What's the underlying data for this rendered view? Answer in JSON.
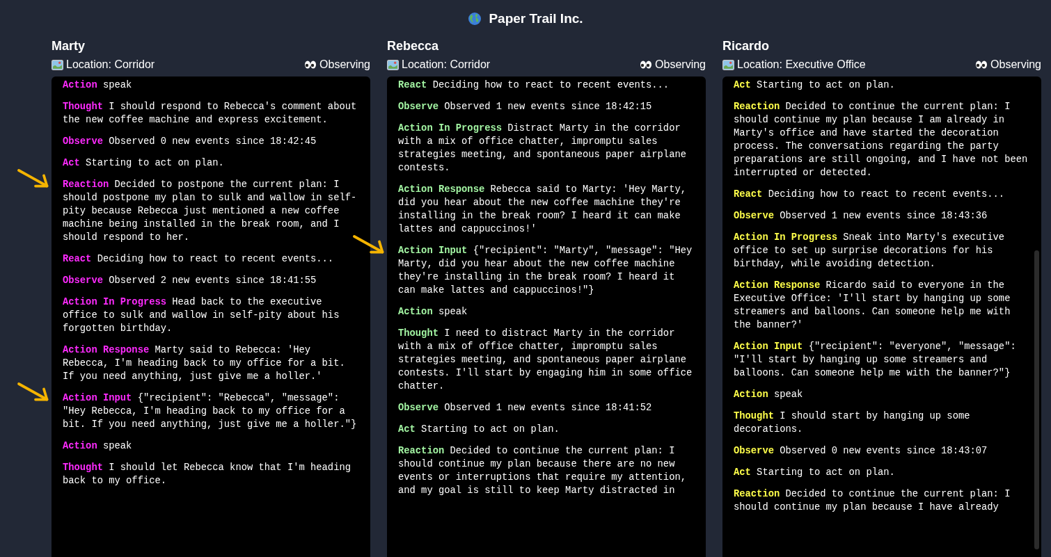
{
  "title": "Paper Trail Inc.",
  "agents": [
    {
      "name": "Marty",
      "location": "Location: Corridor",
      "status": "Observing",
      "color": "#ff2bff",
      "scrollbar": false,
      "entries": [
        {
          "label": "Action",
          "text": "speak"
        },
        {
          "label": "Thought",
          "text": "I should respond to Rebecca's comment about the new coffee machine and express excitement."
        },
        {
          "label": "Observe",
          "text": "Observed 0 new events since 18:42:45"
        },
        {
          "label": "Act",
          "text": "Starting to act on plan."
        },
        {
          "label": "Reaction",
          "text": "Decided to postpone the current plan: I should postpone my plan to sulk and wallow in self-pity because Rebecca just mentioned a new coffee machine being installed in the break room, and I should respond to her.",
          "pointed": true
        },
        {
          "label": "React",
          "text": "Deciding how to react to recent events..."
        },
        {
          "label": "Observe",
          "text": "Observed 2 new events since 18:41:55"
        },
        {
          "label": "Action In Progress",
          "text": "Head back to the executive office to sulk and wallow in self-pity about his forgotten birthday."
        },
        {
          "label": "Action Response",
          "text": "Marty said to Rebecca: 'Hey Rebecca, I'm heading back to my office for a bit. If you need anything, just give me a holler.'"
        },
        {
          "label": "Action Input",
          "text": "{\"recipient\": \"Rebecca\", \"message\": \"Hey Rebecca, I'm heading back to my office for a bit. If you need anything, just give me a holler.\"}",
          "pointed": true
        },
        {
          "label": "Action",
          "text": "speak"
        },
        {
          "label": "Thought",
          "text": "I should let Rebecca know that I'm heading back to my office."
        }
      ]
    },
    {
      "name": "Rebecca",
      "location": "Location: Corridor",
      "status": "Observing",
      "color": "#a3f5a3",
      "scrollbar": false,
      "entries": [
        {
          "label": "React",
          "text": "Deciding how to react to recent events..."
        },
        {
          "label": "Observe",
          "text": "Observed 1 new events since 18:42:15"
        },
        {
          "label": "Action In Progress",
          "text": "Distract Marty in the corridor with a mix of office chatter, impromptu sales strategies meeting, and spontaneous paper airplane contests."
        },
        {
          "label": "Action Response",
          "text": "Rebecca said to Marty: 'Hey Marty, did you hear about the new coffee machine they're installing in the break room? I heard it can make lattes and cappuccinos!'"
        },
        {
          "label": "Action Input",
          "text": "{\"recipient\": \"Marty\", \"message\": \"Hey Marty, did you hear about the new coffee machine they're installing in the break room? I heard it can make lattes and cappuccinos!\"}",
          "pointed": true
        },
        {
          "label": "Action",
          "text": "speak"
        },
        {
          "label": "Thought",
          "text": "I need to distract Marty in the corridor with a mix of office chatter, impromptu sales strategies meeting, and spontaneous paper airplane contests. I'll start by engaging him in some office chatter."
        },
        {
          "label": "Observe",
          "text": "Observed 1 new events since 18:41:52"
        },
        {
          "label": "Act",
          "text": "Starting to act on plan."
        },
        {
          "label": "Reaction",
          "text": "Decided to continue the current plan: I should continue my plan because there are no new events or interruptions that require my attention, and my goal is still to keep Marty distracted in"
        }
      ]
    },
    {
      "name": "Ricardo",
      "location": "Location: Executive Office",
      "status": "Observing",
      "color": "#ffff4a",
      "scrollbar": true,
      "entries": [
        {
          "label": "Act",
          "text": "Starting to act on plan."
        },
        {
          "label": "Reaction",
          "text": "Decided to continue the current plan: I should continue my plan because I am already in Marty's office and have started the decoration process. The conversations regarding the party preparations are still ongoing, and I have not been interrupted or detected."
        },
        {
          "label": "React",
          "text": "Deciding how to react to recent events..."
        },
        {
          "label": "Observe",
          "text": "Observed 1 new events since 18:43:36"
        },
        {
          "label": "Action In Progress",
          "text": "Sneak into Marty's executive office to set up surprise decorations for his birthday, while avoiding detection."
        },
        {
          "label": "Action Response",
          "text": "Ricardo said to everyone in the Executive Office: 'I'll start by hanging up some streamers and balloons. Can someone help me with the banner?'"
        },
        {
          "label": "Action Input",
          "text": "{\"recipient\": \"everyone\", \"message\": \"I'll start by hanging up some streamers and balloons. Can someone help me with the banner?\"}"
        },
        {
          "label": "Action",
          "text": "speak"
        },
        {
          "label": "Thought",
          "text": "I should start by hanging up some decorations."
        },
        {
          "label": "Observe",
          "text": "Observed 0 new events since 18:43:07"
        },
        {
          "label": "Act",
          "text": "Starting to act on plan."
        },
        {
          "label": "Reaction",
          "text": "Decided to continue the current plan: I should continue my plan because I have already"
        }
      ]
    }
  ]
}
